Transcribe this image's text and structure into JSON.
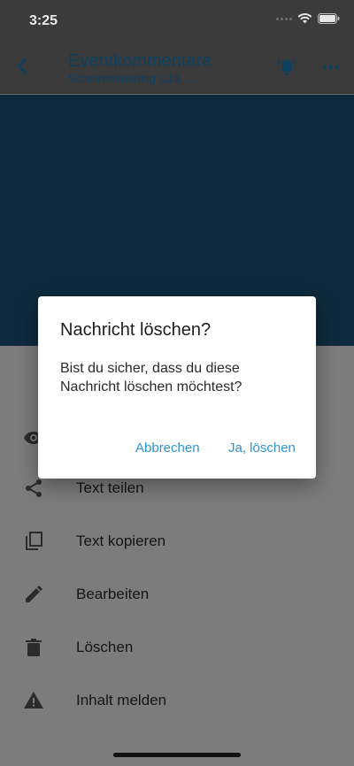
{
  "status_bar": {
    "time": "3:25"
  },
  "app_bar": {
    "title": "Eventkommentare",
    "subtitle": "Schwimmtraining U18, ..."
  },
  "sheet": {
    "items": [
      {
        "label": "Text teilen",
        "icon": "share-icon"
      },
      {
        "label": "Text kopieren",
        "icon": "copy-icon"
      },
      {
        "label": "Bearbeiten",
        "icon": "edit-icon"
      },
      {
        "label": "Löschen",
        "icon": "trash-icon"
      },
      {
        "label": "Inhalt melden",
        "icon": "warning-icon"
      }
    ]
  },
  "dialog": {
    "title": "Nachricht löschen?",
    "message": "Bist du sicher, dass du diese Nachricht löschen möchtest?",
    "cancel_label": "Abbrechen",
    "confirm_label": "Ja, löschen"
  },
  "colors": {
    "accent": "#2d95d4",
    "title_blue": "#0d4160",
    "hero": "#0e2a3d"
  }
}
